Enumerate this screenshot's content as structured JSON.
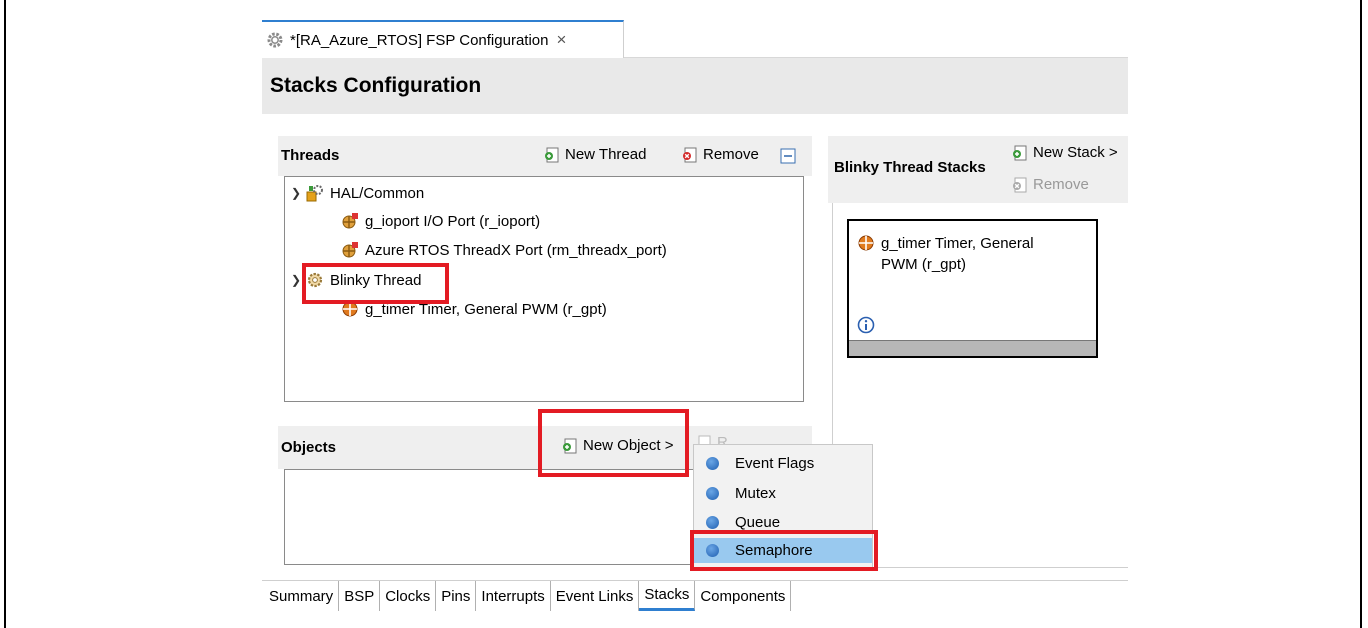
{
  "editor_tab": {
    "title": "*[RA_Azure_RTOS] FSP Configuration",
    "close": "×"
  },
  "header": {
    "title": "Stacks Configuration"
  },
  "threads": {
    "title": "Threads",
    "new_thread": "New Thread",
    "remove": "Remove",
    "tree": [
      {
        "label": "HAL/Common",
        "icon": "hal-common-icon"
      },
      {
        "label": "g_ioport I/O Port (r_ioport)",
        "icon": "component-icon"
      },
      {
        "label": "Azure RTOS ThreadX Port (rm_threadx_port)",
        "icon": "component-icon"
      },
      {
        "label": "Blinky Thread",
        "icon": "thread-gear-icon"
      },
      {
        "label": "g_timer Timer, General PWM (r_gpt)",
        "icon": "module-icon"
      }
    ]
  },
  "stacks": {
    "title": "Blinky Thread Stacks",
    "new_stack": "New Stack >",
    "remove": "Remove",
    "module_line1": "g_timer Timer, General",
    "module_line2": "PWM (r_gpt)",
    "info_icon": "info-icon"
  },
  "objects": {
    "title": "Objects",
    "new_object": "New Object >",
    "remove_partial": "R..."
  },
  "menu": {
    "items": [
      {
        "label": "Event Flags"
      },
      {
        "label": "Mutex"
      },
      {
        "label": "Queue"
      },
      {
        "label": "Semaphore",
        "selected": true
      }
    ]
  },
  "bottom_tabs": [
    {
      "label": "Summary"
    },
    {
      "label": "BSP"
    },
    {
      "label": "Clocks"
    },
    {
      "label": "Pins"
    },
    {
      "label": "Interrupts"
    },
    {
      "label": "Event Links"
    },
    {
      "label": "Stacks",
      "active": true
    },
    {
      "label": "Components"
    }
  ],
  "colors": {
    "highlight": "#e31b23",
    "accent": "#2f7fd0",
    "menu_selected": "#99c9ef"
  }
}
